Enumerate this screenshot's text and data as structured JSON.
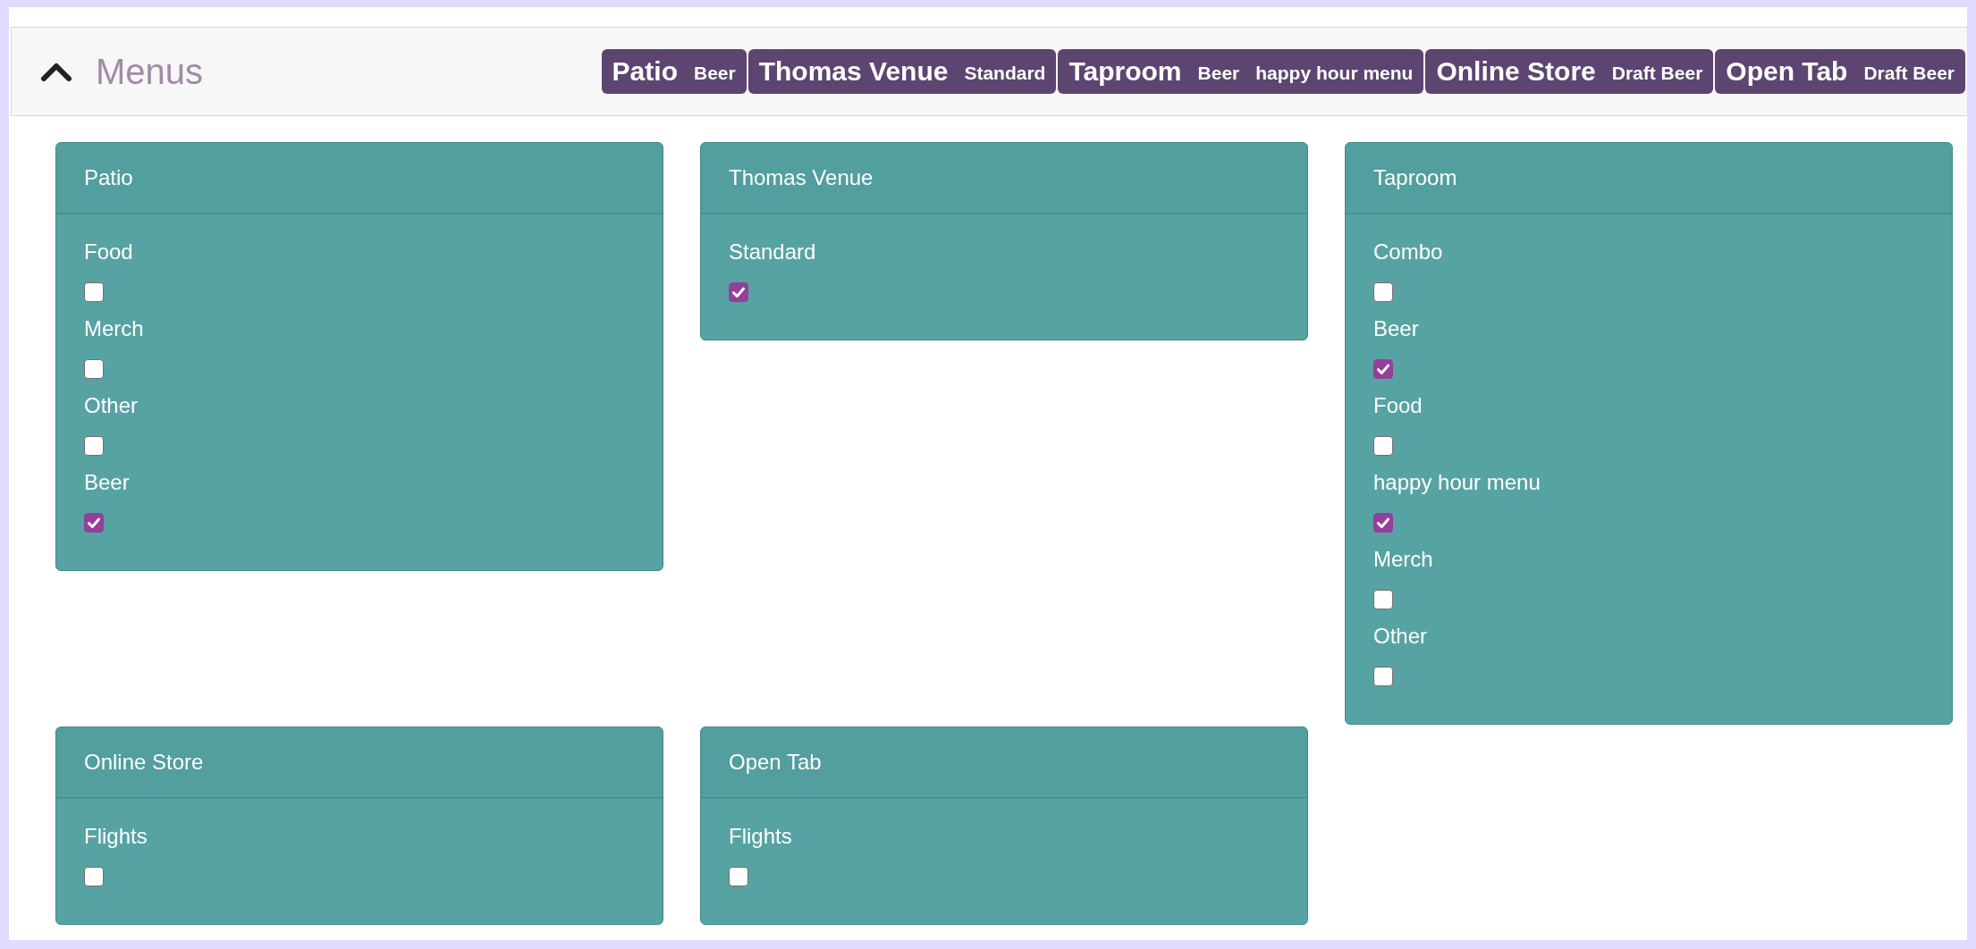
{
  "header": {
    "title": "Menus",
    "expanded": true,
    "badges": [
      {
        "title": "Patio",
        "tags": [
          "Beer"
        ]
      },
      {
        "title": "Thomas Venue",
        "tags": [
          "Standard"
        ]
      },
      {
        "title": "Taproom",
        "tags": [
          "Beer",
          "happy hour menu"
        ]
      },
      {
        "title": "Online Store",
        "tags": [
          "Draft Beer"
        ]
      },
      {
        "title": "Open Tab",
        "tags": [
          "Draft Beer"
        ]
      }
    ]
  },
  "cards": [
    {
      "title": "Patio",
      "items": [
        {
          "label": "Food",
          "checked": false
        },
        {
          "label": "Merch",
          "checked": false
        },
        {
          "label": "Other",
          "checked": false
        },
        {
          "label": "Beer",
          "checked": true
        }
      ]
    },
    {
      "title": "Thomas Venue",
      "items": [
        {
          "label": "Standard",
          "checked": true
        }
      ]
    },
    {
      "title": "Taproom",
      "items": [
        {
          "label": "Combo",
          "checked": false
        },
        {
          "label": "Beer",
          "checked": true
        },
        {
          "label": "Food",
          "checked": false
        },
        {
          "label": "happy hour menu",
          "checked": true
        },
        {
          "label": "Merch",
          "checked": false
        },
        {
          "label": "Other",
          "checked": false
        }
      ]
    },
    {
      "title": "Online Store",
      "items": [
        {
          "label": "Flights",
          "checked": false
        }
      ]
    },
    {
      "title": "Open Tab",
      "items": [
        {
          "label": "Flights",
          "checked": false
        }
      ]
    }
  ]
}
